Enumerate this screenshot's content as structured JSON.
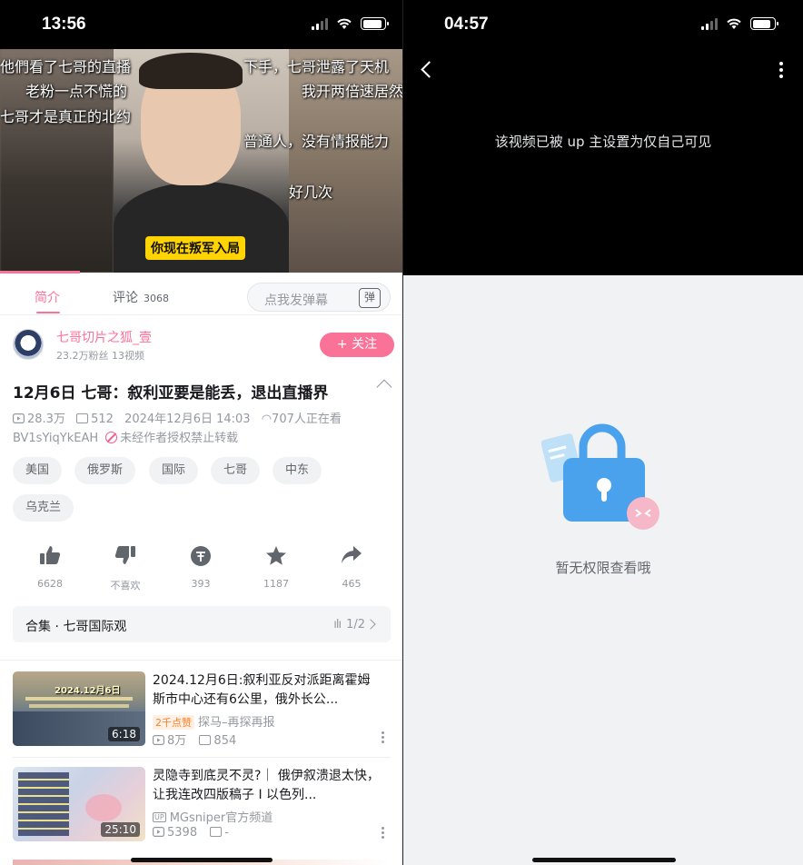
{
  "left": {
    "status": {
      "time": "13:56"
    },
    "video_overlay": {
      "lines": [
        "他們看了七哥的直播",
        "下手，七哥泄露了天机",
        "老粉一点不慌的",
        "我开两倍速居然",
        "七哥才是真正的北约",
        "普通人，没有情报能力",
        "好几次"
      ],
      "subtitle": "你现在叛军入局"
    },
    "tabs": {
      "intro": "简介",
      "comments": "评论",
      "comments_count": "3068",
      "danmaku_placeholder": "点我发弹幕",
      "danmaku_btn": "弹"
    },
    "author": {
      "name": "七哥切片之狐_壹",
      "stats": "23.2万粉丝  13视频",
      "follow": "+ 关注"
    },
    "video": {
      "title": "12月6日 七哥：叙利亚要是能丢，退出直播界",
      "views": "28.3万",
      "danmaku": "512",
      "date": "2024年12月6日 14:03",
      "watching": "707人正在看",
      "bvid": "BV1sYiqYkEAH",
      "no_repost": "未经作者授权禁止转载"
    },
    "tags": [
      "美国",
      "俄罗斯",
      "国际",
      "七哥",
      "中东",
      "乌克兰"
    ],
    "actions": [
      {
        "icon": "thumbs-up-icon",
        "label": "6628"
      },
      {
        "icon": "thumbs-down-icon",
        "label": "不喜欢"
      },
      {
        "icon": "coin-icon",
        "label": "393"
      },
      {
        "icon": "star-icon",
        "label": "1187"
      },
      {
        "icon": "share-icon",
        "label": "465"
      }
    ],
    "collection": {
      "title": "合集 · 七哥国际观",
      "progress": "1/2"
    },
    "recommendations": [
      {
        "title": "2024.12月6日:叙利亚反对派距离霍姆斯市中心还有6公里，俄外长公...",
        "duration": "6:18",
        "badge": "2千点赞",
        "source": "探马–再探再报",
        "views": "8万",
        "danmaku": "854",
        "thumb_text": "2024.12月6日"
      },
      {
        "title": "灵隐寺到底灵不灵?｜ 俄伊叙溃退太快，让我连改四版稿子 I 以色列...",
        "duration": "25:10",
        "badge": "UP",
        "source": "MGsniper官方频道",
        "views": "5398",
        "danmaku": "-",
        "thumb_text": ""
      }
    ]
  },
  "right": {
    "status": {
      "time": "04:57"
    },
    "private_message": "该视频已被 up 主设置为仅自己可见",
    "no_permission": "暂无权限查看哦"
  }
}
